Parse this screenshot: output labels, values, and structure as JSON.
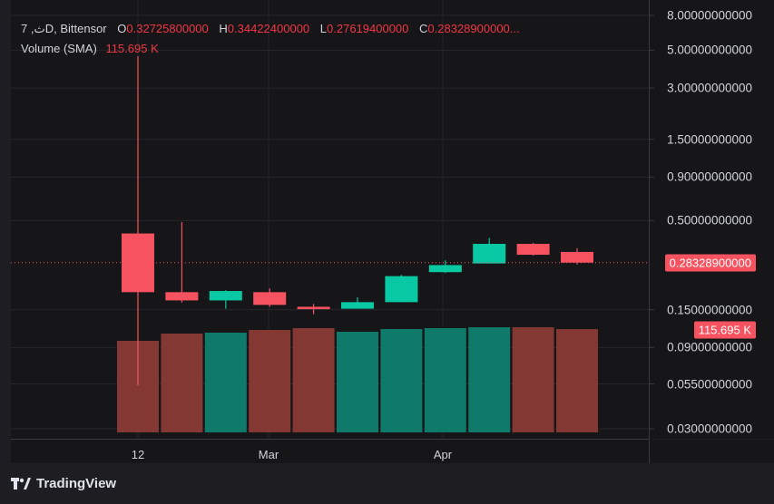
{
  "header": {
    "symbol": "7 ,ثD, Bittensor",
    "o_label": "O",
    "o_value": "0.32725800000",
    "h_label": "H",
    "h_value": "0.34422400000",
    "l_label": "L",
    "l_value": "0.27619400000",
    "c_label": "C",
    "c_value": "0.28328900000...",
    "volume_label": "Volume (SMA)",
    "volume_value": "115.695 K"
  },
  "price_badge": "0.28328900000",
  "volume_badge": "115.695 K",
  "branding": "TradingView",
  "colors": {
    "up": "#08c9a4",
    "down": "#f7525f",
    "vol_up": "#0f7a6a",
    "vol_down": "#833833"
  },
  "chart_data": {
    "type": "candlestick",
    "y_scale": "log",
    "y_ticks": [
      "8.00000000000",
      "5.00000000000",
      "3.00000000000",
      "1.50000000000",
      "0.90000000000",
      "0.50000000000",
      "0.15000000000",
      "0.09000000000",
      "0.05500000000",
      "0.03000000000"
    ],
    "x_ticks": [
      "12",
      "Mar",
      "Apr"
    ],
    "candles": [
      {
        "o": 0.42,
        "h": 4.6,
        "l": 0.054,
        "c": 0.19
      },
      {
        "o": 0.19,
        "h": 0.49,
        "l": 0.165,
        "c": 0.17
      },
      {
        "o": 0.17,
        "h": 0.195,
        "l": 0.152,
        "c": 0.193
      },
      {
        "o": 0.19,
        "h": 0.2,
        "l": 0.156,
        "c": 0.16
      },
      {
        "o": 0.156,
        "h": 0.162,
        "l": 0.141,
        "c": 0.151
      },
      {
        "o": 0.152,
        "h": 0.177,
        "l": 0.152,
        "c": 0.166
      },
      {
        "o": 0.166,
        "h": 0.24,
        "l": 0.166,
        "c": 0.236
      },
      {
        "o": 0.249,
        "h": 0.292,
        "l": 0.246,
        "c": 0.274
      },
      {
        "o": 0.28,
        "h": 0.395,
        "l": 0.28,
        "c": 0.365
      },
      {
        "o": 0.365,
        "h": 0.37,
        "l": 0.312,
        "c": 0.315
      },
      {
        "o": 0.3273,
        "h": 0.3442,
        "l": 0.2762,
        "c": 0.2833
      }
    ],
    "volume_trend": [
      "down",
      "down",
      "up",
      "down",
      "down",
      "up",
      "up",
      "up",
      "up",
      "down",
      "down"
    ],
    "last_price": 0.283289,
    "last_volume_sma": "115.695 K"
  }
}
